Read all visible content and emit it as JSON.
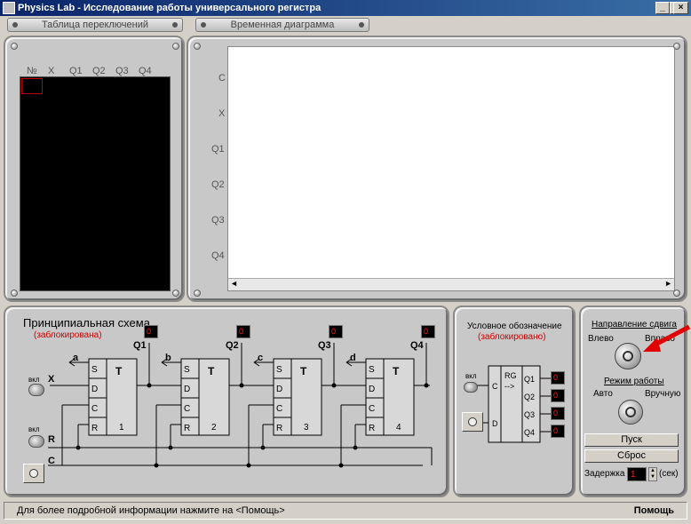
{
  "window": {
    "title": "Physics Lab - Исследование работы универсального регистра",
    "minimize": "_",
    "maximize": "□",
    "close": "×"
  },
  "tabs": {
    "switch_table": "Таблица переключений",
    "timing_diagram": "Временная диаграмма"
  },
  "switch_table": {
    "columns": [
      "№",
      "X",
      "Q1",
      "Q2",
      "Q3",
      "Q4"
    ]
  },
  "timing_diagram": {
    "rows": [
      "C",
      "X",
      "Q1",
      "Q2",
      "Q3",
      "Q4"
    ],
    "scroll_left": "◄",
    "scroll_right": "►"
  },
  "schematic": {
    "title": "Принципиальная схема",
    "status": "(заблокирована)",
    "switch_label": "вкл",
    "input_x": "X",
    "input_r": "R",
    "input_c": "C",
    "outputs": [
      "Q1",
      "Q2",
      "Q3",
      "Q4"
    ],
    "arrows": [
      "a",
      "b",
      "c",
      "d"
    ],
    "led_values": [
      "0",
      "0",
      "0",
      "0"
    ],
    "flipflop": {
      "type": "T",
      "pins": [
        "S",
        "D",
        "C",
        "R"
      ],
      "numbers": [
        "1",
        "2",
        "3",
        "4"
      ]
    }
  },
  "symbol": {
    "title": "Условное обозначение",
    "status": "(заблокировано)",
    "switch_label": "вкл",
    "pin_c": "C",
    "pin_d": "D",
    "rg": "RG",
    "arrow": "-->",
    "outputs": [
      "Q1",
      "Q2",
      "Q3",
      "Q4"
    ],
    "led_values": [
      "0",
      "0",
      "0",
      "0"
    ]
  },
  "controls": {
    "shift_direction": "Направление сдвига",
    "left": "Влево",
    "right": "Вправо",
    "mode": "Режим работы",
    "auto": "Авто",
    "manual": "Вручную",
    "start": "Пуск",
    "reset": "Сброс",
    "delay_label": "Задержка",
    "delay_value": "1",
    "delay_unit": "(сек)"
  },
  "status": {
    "hint": "Для более подробной информации нажмите на <Помощь>",
    "help": "Помощь"
  },
  "colors": {
    "titlebar": "#0a246a",
    "led_red": "#ff2020",
    "status_red": "#d00000",
    "pointer_red": "#e00000"
  }
}
